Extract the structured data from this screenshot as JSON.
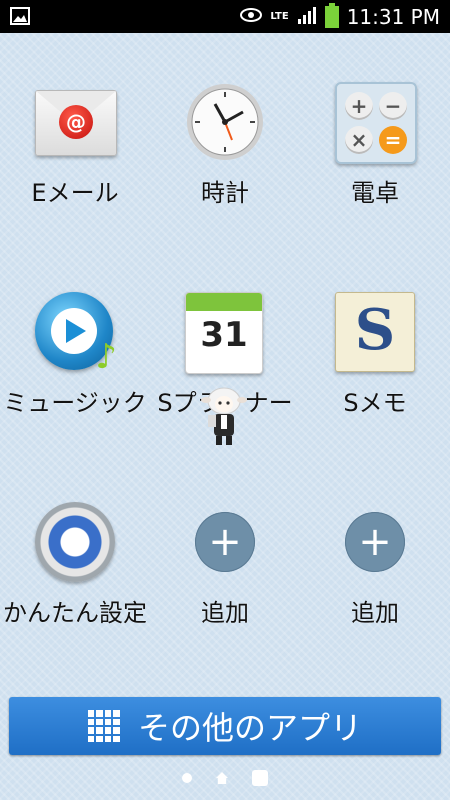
{
  "status_bar": {
    "time": "11:31 PM",
    "network": "LTE"
  },
  "apps": [
    {
      "label": "Eメール",
      "icon": "email-icon"
    },
    {
      "label": "時計",
      "icon": "clock-icon"
    },
    {
      "label": "電卓",
      "icon": "calculator-icon"
    },
    {
      "label": "ミュージック",
      "icon": "music-icon"
    },
    {
      "label": "Sプランナー",
      "icon": "calendar-icon",
      "date_number": "31"
    },
    {
      "label": "Sメモ",
      "icon": "memo-icon",
      "letter": "S"
    },
    {
      "label": "かんたん設定",
      "icon": "settings-gear-icon"
    },
    {
      "label": "追加",
      "icon": "add-icon"
    },
    {
      "label": "追加",
      "icon": "add-icon"
    }
  ],
  "more_apps": {
    "label": "その他のアプリ"
  },
  "colors": {
    "accent": "#2d7fd6",
    "background": "#cfe0ef"
  }
}
